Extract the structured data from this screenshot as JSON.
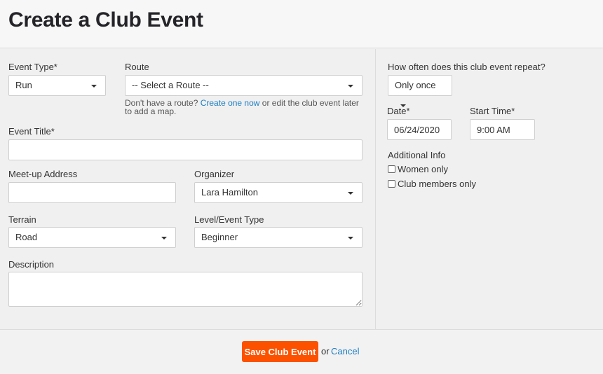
{
  "header": {
    "title": "Create a Club Event"
  },
  "form": {
    "event_type": {
      "label": "Event Type*",
      "value": "Run"
    },
    "route": {
      "label": "Route",
      "value": "-- Select a Route --",
      "hint_prefix": "Don't have a route?",
      "hint_link": "Create one now",
      "hint_suffix": "or edit the club event later to add a map."
    },
    "event_title": {
      "label": "Event Title*",
      "value": ""
    },
    "meetup_address": {
      "label": "Meet-up Address",
      "value": ""
    },
    "organizer": {
      "label": "Organizer",
      "value": "Lara Hamilton"
    },
    "terrain": {
      "label": "Terrain",
      "value": "Road"
    },
    "level": {
      "label": "Level/Event Type",
      "value": "Beginner"
    },
    "description": {
      "label": "Description",
      "value": ""
    }
  },
  "schedule": {
    "repeat": {
      "label": "How often does this club event repeat?",
      "value": "Only once"
    },
    "date": {
      "label": "Date*",
      "value": "06/24/2020"
    },
    "start_time": {
      "label": "Start Time*",
      "value": "9:00 AM"
    },
    "additional_info": {
      "label": "Additional Info",
      "women_only": "Women only",
      "club_members_only": "Club members only"
    }
  },
  "footer": {
    "save_label": "Save Club Event",
    "or_text": "or",
    "cancel_label": "Cancel"
  },
  "colors": {
    "accent": "#fc5200",
    "link": "#1a7ec4"
  }
}
